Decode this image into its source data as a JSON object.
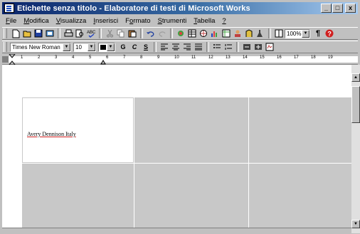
{
  "window": {
    "title": "Etichette senza titolo - Elaboratore di testi di Microsoft Works",
    "minimize": "_",
    "maximize": "□",
    "close": "x"
  },
  "menu": [
    {
      "pre": "",
      "u": "F",
      "post": "ile"
    },
    {
      "pre": "",
      "u": "M",
      "post": "odifica"
    },
    {
      "pre": "",
      "u": "V",
      "post": "isualizza"
    },
    {
      "pre": "",
      "u": "I",
      "post": "nserisci"
    },
    {
      "pre": "F",
      "u": "o",
      "post": "rmato"
    },
    {
      "pre": "",
      "u": "S",
      "post": "trumenti"
    },
    {
      "pre": "",
      "u": "T",
      "post": "abella"
    },
    {
      "pre": "",
      "u": "?",
      "post": ""
    }
  ],
  "toolbar": {
    "zoom": "100%",
    "font": "Times New Roman",
    "size": "10",
    "bold": "G",
    "italic": "C",
    "underline": "S",
    "pilcrow": "¶",
    "help": "?"
  },
  "ruler": {
    "numbers": [
      "1",
      "2",
      "3",
      "4",
      "5",
      "6",
      "7",
      "8",
      "9",
      "10",
      "11",
      "12",
      "13",
      "14",
      "15",
      "16",
      "17",
      "18",
      "19"
    ]
  },
  "document": {
    "label_text": "Avery Dennison Italy"
  },
  "colors": {
    "title_start": "#0a246a",
    "title_end": "#a6caf0",
    "label_gray": "#c8c8c8"
  }
}
